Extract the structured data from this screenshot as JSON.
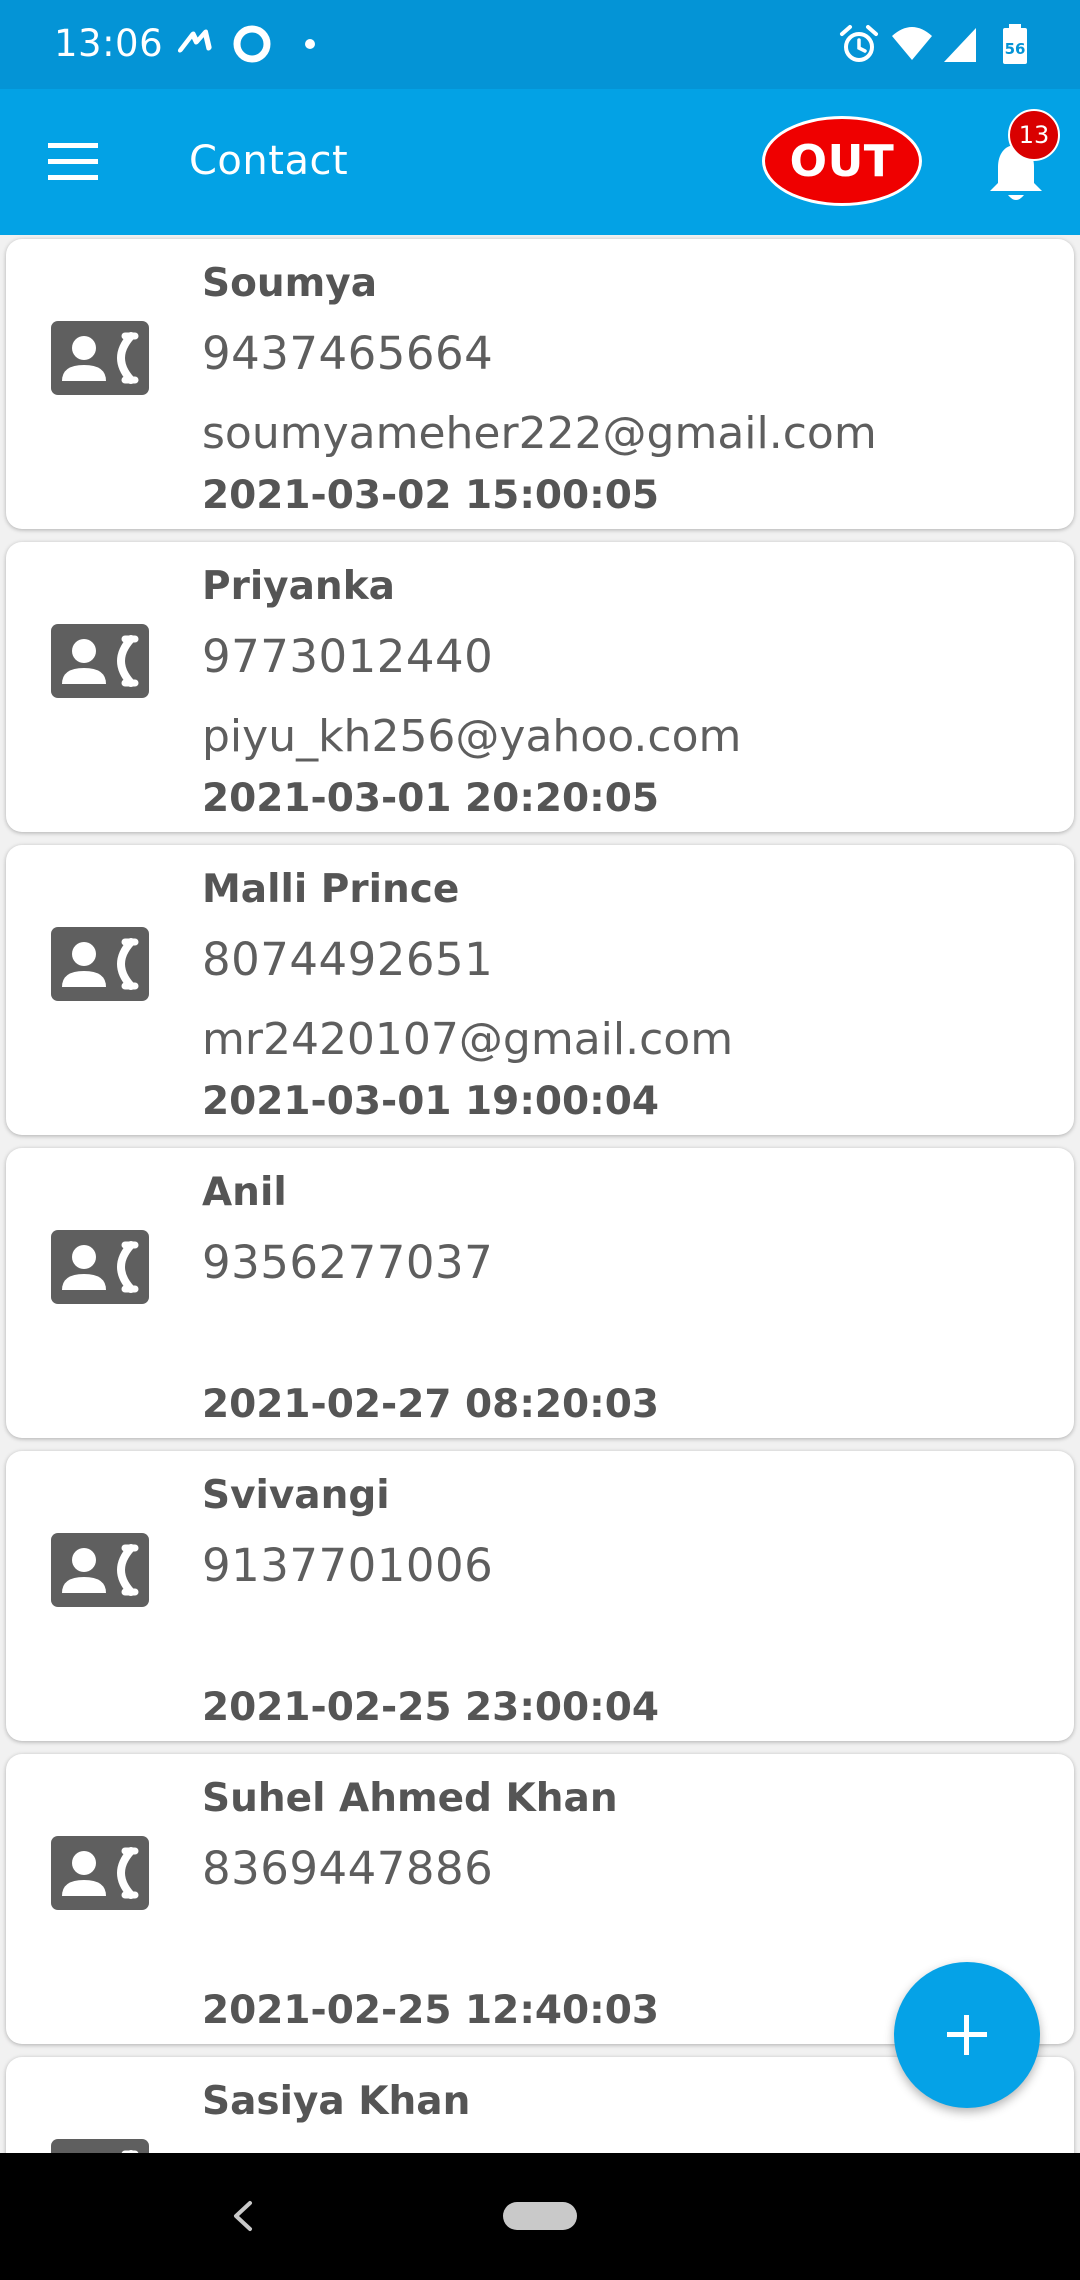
{
  "status_bar": {
    "time": "13:06",
    "battery_level": "56",
    "icons": [
      "cloud-sync-icon",
      "circle-icon",
      "dot-icon",
      "alarm-icon",
      "wifi-icon",
      "signal-icon",
      "battery-icon"
    ]
  },
  "app_bar": {
    "title": "Contact",
    "out_label": "OUT",
    "notification_count": "13"
  },
  "contacts": [
    {
      "name": "Soumya",
      "phone": "9437465664",
      "email": "soumyameher222@gmail.com",
      "date": "2021-03-02 15:00:05"
    },
    {
      "name": "Priyanka",
      "phone": "9773012440",
      "email": "piyu_kh256@yahoo.com",
      "date": "2021-03-01 20:20:05"
    },
    {
      "name": "Malli Prince",
      "phone": "8074492651",
      "email": "mr2420107@gmail.com",
      "date": "2021-03-01 19:00:04"
    },
    {
      "name": "Anil",
      "phone": "9356277037",
      "email": "",
      "date": "2021-02-27 08:20:03"
    },
    {
      "name": "Svivangi",
      "phone": "9137701006",
      "email": "",
      "date": "2021-02-25 23:00:04"
    },
    {
      "name": "Suhel Ahmed Khan",
      "phone": "8369447886",
      "email": "",
      "date": "2021-02-25 12:40:03"
    },
    {
      "name": "Sasiya Khan",
      "phone": "",
      "email": "",
      "date": ""
    }
  ],
  "colors": {
    "status_bar": "#0494d6",
    "app_bar": "#03a2e5",
    "out_button": "#ef0000",
    "badge": "#d90000",
    "fab": "#05a2e7",
    "text": "#555555"
  }
}
